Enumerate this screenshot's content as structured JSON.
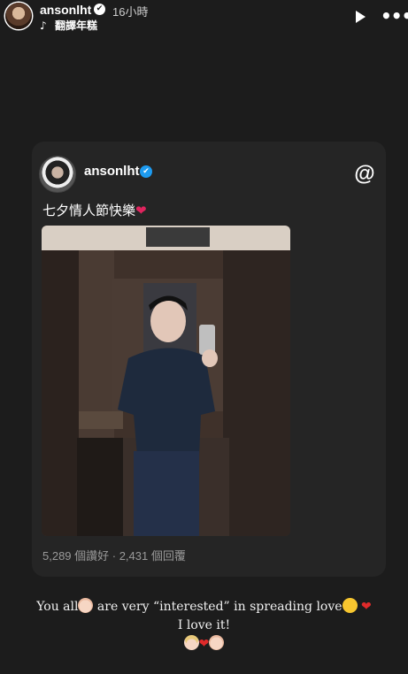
{
  "header": {
    "username": "ansonlht",
    "verified_glyph": "✔",
    "time": "16小時",
    "music_icon": "music-note-icon",
    "music_glyph": "♪",
    "music_label": "翻譯年糕",
    "play_icon": "play-icon",
    "more_glyph": "•••"
  },
  "card": {
    "username": "ansonlht",
    "verified_glyph": "✔",
    "threads_glyph": "@",
    "caption_text": "七夕情人節快樂",
    "caption_emoji": "❤",
    "stats": "5,289 個讚好 · 2,431 個回覆"
  },
  "story_caption": {
    "line1_a": "You all",
    "line1_b": " are very “interested” in spreading love",
    "line2": "I love it!",
    "heart": "❤"
  },
  "colors": {
    "background": "#1c1c1c",
    "card": "#252525",
    "verified_blue": "#1d9bf0",
    "heart_red": "#e0245e"
  }
}
